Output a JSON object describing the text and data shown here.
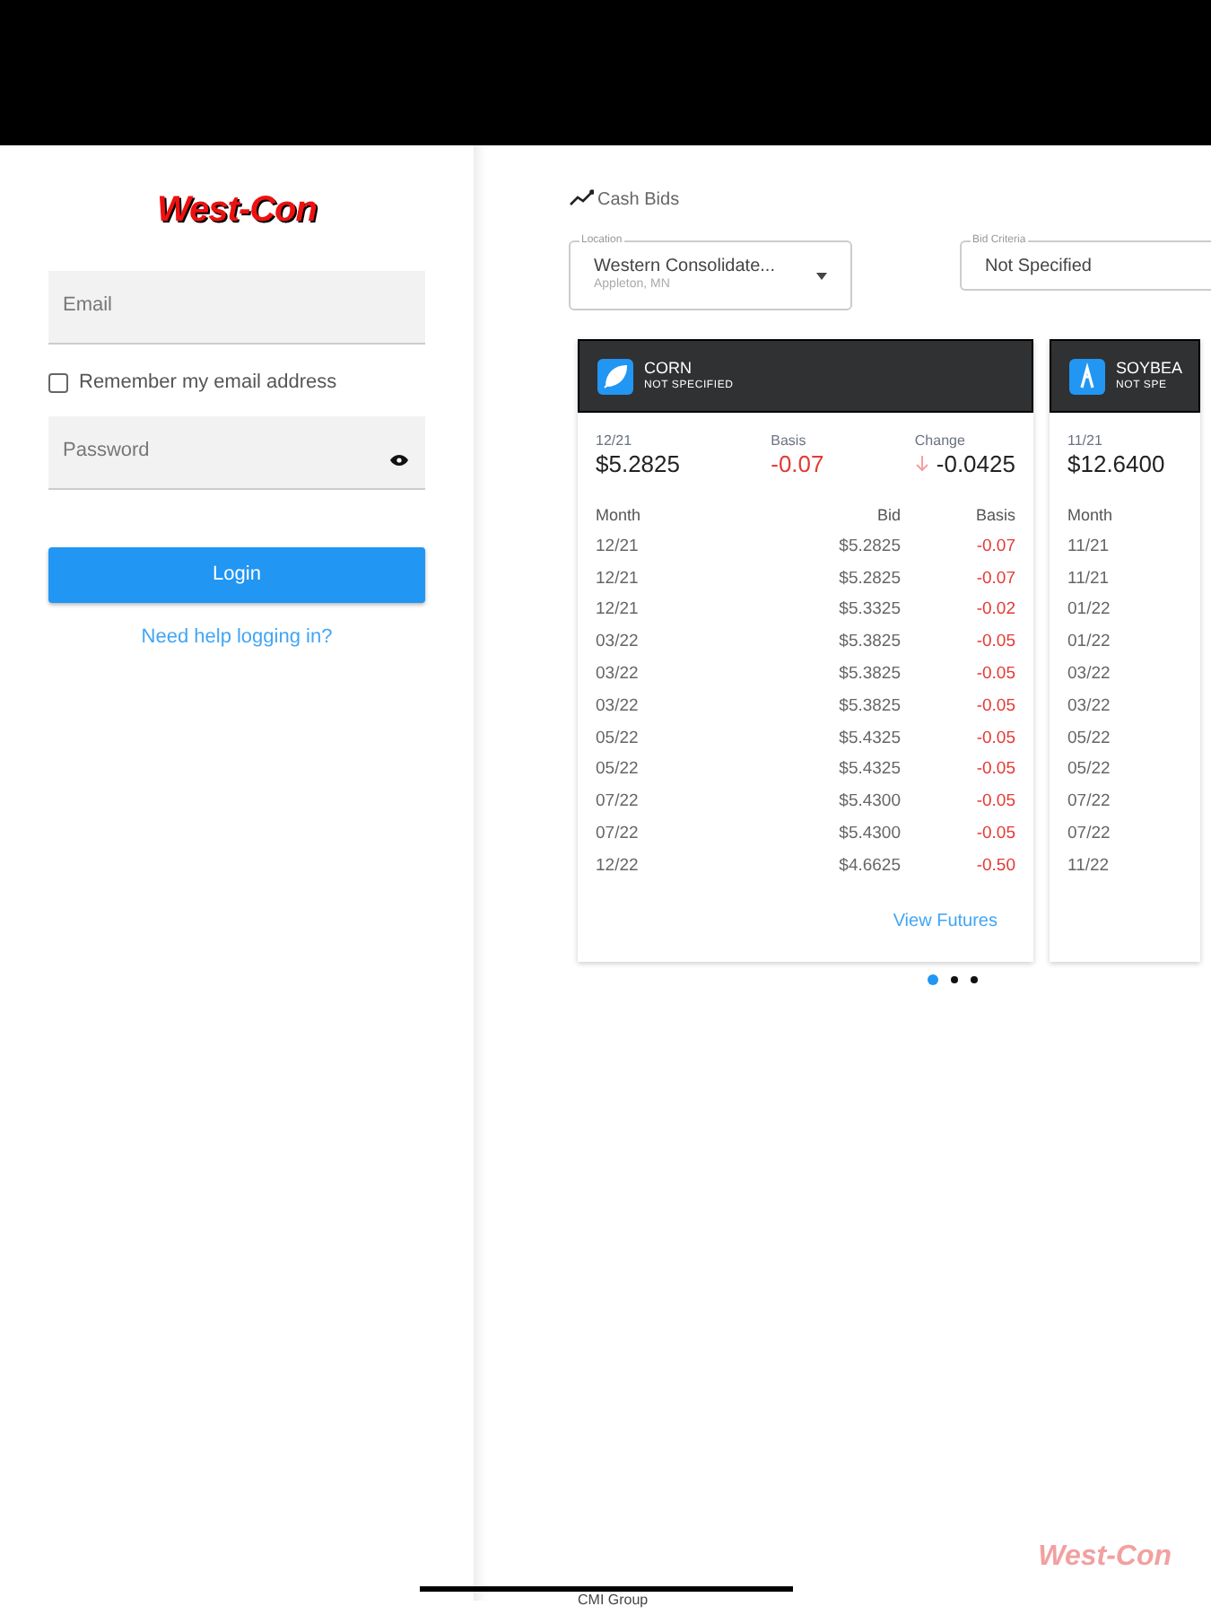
{
  "logo": {
    "text": "West-Con"
  },
  "login": {
    "email": {
      "placeholder": "Email"
    },
    "remember": {
      "label": "Remember my email address",
      "checked": false
    },
    "password": {
      "placeholder": "Password"
    },
    "button": "Login",
    "help_link": "Need help logging in?"
  },
  "cash_bids": {
    "title": "Cash Bids",
    "location": {
      "label": "Location",
      "value": "Western Consolidate...",
      "sub": "Appleton, MN"
    },
    "bid_criteria": {
      "label": "Bid Criteria",
      "value": "Not Specified"
    },
    "cards": [
      {
        "name": "CORN",
        "criteria": "NOT SPECIFIED",
        "kind": "leaf",
        "summary": {
          "month": "12/21",
          "price": "$5.2825",
          "basis_label": "Basis",
          "basis": "-0.07",
          "change_label": "Change",
          "change": "-0.0425"
        },
        "columns": [
          "Month",
          "Bid",
          "Basis"
        ],
        "rows": [
          [
            "12/21",
            "$5.2825",
            "-0.07"
          ],
          [
            "12/21",
            "$5.2825",
            "-0.07"
          ],
          [
            "12/21",
            "$5.3325",
            "-0.02"
          ],
          [
            "03/22",
            "$5.3825",
            "-0.05"
          ],
          [
            "03/22",
            "$5.3825",
            "-0.05"
          ],
          [
            "03/22",
            "$5.3825",
            "-0.05"
          ],
          [
            "05/22",
            "$5.4325",
            "-0.05"
          ],
          [
            "05/22",
            "$5.4325",
            "-0.05"
          ],
          [
            "07/22",
            "$5.4300",
            "-0.05"
          ],
          [
            "07/22",
            "$5.4300",
            "-0.05"
          ],
          [
            "12/22",
            "$4.6625",
            "-0.50"
          ]
        ],
        "link": "View Futures"
      },
      {
        "name": "SOYBEA",
        "criteria": "NOT SPE",
        "kind": "bean",
        "summary": {
          "month": "11/21",
          "price": "$12.6400"
        },
        "columns": [
          "Month"
        ],
        "rows": [
          [
            "11/21"
          ],
          [
            "11/21"
          ],
          [
            "01/22"
          ],
          [
            "01/22"
          ],
          [
            "03/22"
          ],
          [
            "03/22"
          ],
          [
            "05/22"
          ],
          [
            "05/22"
          ],
          [
            "07/22"
          ],
          [
            "07/22"
          ],
          [
            "11/22"
          ]
        ]
      }
    ],
    "pager": [
      {
        "selected": true
      },
      {
        "selected": false
      },
      {
        "selected": false
      }
    ]
  },
  "footer": {
    "logo": "West-Con",
    "company": "CMI Group"
  }
}
